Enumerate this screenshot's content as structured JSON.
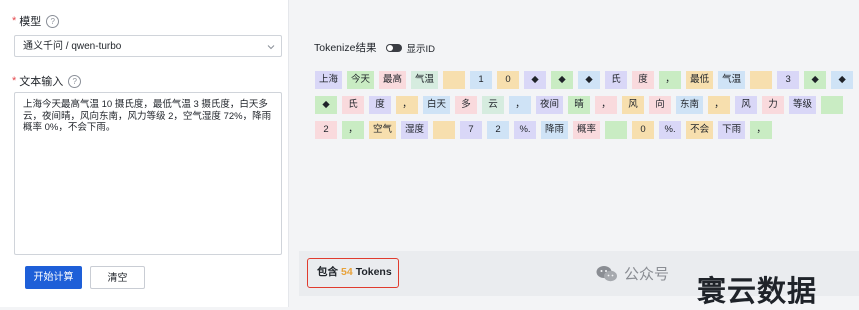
{
  "form": {
    "model_label": "模型",
    "model_value": "通义千问 / qwen-turbo",
    "text_label": "文本输入",
    "text_value": "上海今天最高气温 10 摄氏度，最低气温 3 摄氏度，白天多云，夜间晴，风向东南，风力等级 2，空气湿度 72%，降雨概率 0%，不会下雨。",
    "start_button": "开始计算",
    "clear_button": "清空"
  },
  "tokenize": {
    "title": "Tokenize结果",
    "show_id_label": "显示ID",
    "rows": [
      [
        {
          "text": "上海",
          "color": "#d9d7f7"
        },
        {
          "text": "今天",
          "color": "#c9ecc3"
        },
        {
          "text": "最高",
          "color": "#f9dadd"
        },
        {
          "text": "气温",
          "color": "#d6ecdf"
        },
        {
          "text": "",
          "color": "#f7dfae"
        },
        {
          "text": "1",
          "color": "#cfe3f6"
        },
        {
          "text": "0",
          "color": "#f7dfae"
        },
        {
          "text": "◆",
          "color": "#d9d7f7"
        },
        {
          "text": "◆",
          "color": "#c9ecc3"
        },
        {
          "text": "◆",
          "color": "#cfe3f6"
        },
        {
          "text": "氏",
          "color": "#d9d7f7"
        },
        {
          "text": "度",
          "color": "#f9dadd"
        },
        {
          "text": "，",
          "color": "#c9ecc3"
        },
        {
          "text": "最低",
          "color": "#f7dfae"
        },
        {
          "text": "气温",
          "color": "#cfe3f6"
        },
        {
          "text": "",
          "color": "#f7dfae"
        },
        {
          "text": "3",
          "color": "#d9d7f7"
        },
        {
          "text": "◆",
          "color": "#c9ecc3"
        },
        {
          "text": "◆",
          "color": "#cfe3f6"
        }
      ],
      [
        {
          "text": "◆",
          "color": "#c9ecc3"
        },
        {
          "text": "氏",
          "color": "#f9dadd"
        },
        {
          "text": "度",
          "color": "#d9d7f7"
        },
        {
          "text": "，",
          "color": "#f7dfae"
        },
        {
          "text": "白天",
          "color": "#cfe3f6"
        },
        {
          "text": "多",
          "color": "#f9dadd"
        },
        {
          "text": "云",
          "color": "#d6ecdf"
        },
        {
          "text": "，",
          "color": "#cfe3f6"
        },
        {
          "text": "夜间",
          "color": "#d9d7f7"
        },
        {
          "text": "晴",
          "color": "#c9ecc3"
        },
        {
          "text": "，",
          "color": "#f9dadd"
        },
        {
          "text": "风",
          "color": "#f7dfae"
        },
        {
          "text": "向",
          "color": "#f9dadd"
        },
        {
          "text": "东南",
          "color": "#cfe3f6"
        },
        {
          "text": "，",
          "color": "#f7dfae"
        },
        {
          "text": "风",
          "color": "#d9d7f7"
        },
        {
          "text": "力",
          "color": "#f9dadd"
        },
        {
          "text": "等级",
          "color": "#d9d7f7"
        },
        {
          "text": "",
          "color": "#c9ecc3"
        }
      ],
      [
        {
          "text": "2",
          "color": "#f9dadd"
        },
        {
          "text": "，",
          "color": "#c9ecc3"
        },
        {
          "text": "空气",
          "color": "#f7dfae"
        },
        {
          "text": "湿度",
          "color": "#d9d7f7"
        },
        {
          "text": "",
          "color": "#f7dfae"
        },
        {
          "text": "7",
          "color": "#d9d7f7"
        },
        {
          "text": "2",
          "color": "#cfe3f6"
        },
        {
          "text": "%.",
          "color": "#d9d7f7"
        },
        {
          "text": "降雨",
          "color": "#cfe3f6"
        },
        {
          "text": "概率",
          "color": "#f9dadd"
        },
        {
          "text": "",
          "color": "#c9ecc3"
        },
        {
          "text": "0",
          "color": "#f7dfae"
        },
        {
          "text": "%.",
          "color": "#d9d7f7"
        },
        {
          "text": "不会",
          "color": "#f7dfae"
        },
        {
          "text": "下雨",
          "color": "#d9d7f7"
        },
        {
          "text": "，",
          "color": "#c9ecc3"
        }
      ]
    ],
    "count_prefix": "包含",
    "count_value": "54",
    "count_suffix": "Tokens"
  },
  "watermark": {
    "small_text": "公众号",
    "big_text": "寰云数据"
  }
}
